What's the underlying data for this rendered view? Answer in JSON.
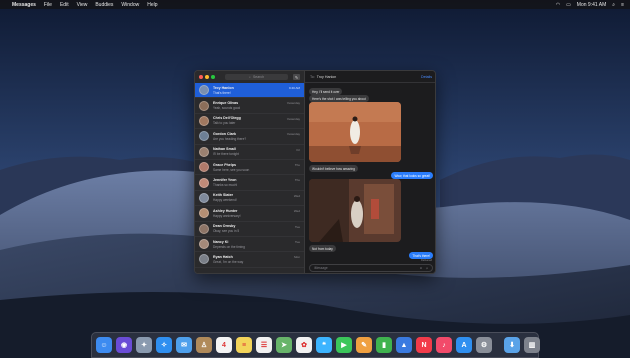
{
  "menubar": {
    "app_name": "Messages",
    "items": [
      "File",
      "Edit",
      "View",
      "Buddies",
      "Window",
      "Help"
    ],
    "clock": "Mon 9:41 AM"
  },
  "sidebar": {
    "search_placeholder": "Search",
    "conversations": [
      {
        "name": "Troy Hanlon",
        "preview": "That's there!",
        "time": "9:40 AM",
        "avatar_color": "#7a8fb0",
        "active": true
      },
      {
        "name": "Enrique Olivas",
        "preview": "Yeah, sounds good",
        "time": "Yesterday",
        "avatar_color": "#8c6e5a"
      },
      {
        "name": "Chris Dell'Olegg",
        "preview": "Talk to you later",
        "time": "Yesterday",
        "avatar_color": "#a07860"
      },
      {
        "name": "Gordon Clark",
        "preview": "Are you heading there?",
        "time": "Yesterday",
        "avatar_color": "#6d7f95"
      },
      {
        "name": "Nathan Small",
        "preview": "I'll be there tonight",
        "time": "Fri",
        "avatar_color": "#9a8070"
      },
      {
        "name": "Grace Phelps",
        "preview": "Same here, see you soon",
        "time": "Thu",
        "avatar_color": "#b07a6a"
      },
      {
        "name": "Jennifer Yeon",
        "preview": "Thanks so much!",
        "time": "Thu",
        "avatar_color": "#c08a78"
      },
      {
        "name": "Keith Slater",
        "preview": "Happy weekend!",
        "time": "Wed",
        "avatar_color": "#7f8a9c"
      },
      {
        "name": "Ashley Hunter",
        "preview": "Happy anniversary!",
        "time": "Wed",
        "avatar_color": "#b58f74"
      },
      {
        "name": "Dean Ornsby",
        "preview": "Okay, see you in 5",
        "time": "Tue",
        "avatar_color": "#8d7466"
      },
      {
        "name": "Nancy Ki",
        "preview": "Depends on the timing",
        "time": "Tue",
        "avatar_color": "#a58a7a"
      },
      {
        "name": "Ryan Hatch",
        "preview": "Great, I'm on the way",
        "time": "Mon",
        "avatar_color": "#7a7f88"
      }
    ]
  },
  "chat": {
    "to_label": "To:",
    "recipient": "Troy Hanlon",
    "details_label": "Details",
    "messages": [
      {
        "text": "Hey, I'll send it over",
        "dir": "in"
      },
      {
        "text": "Here's the shot I was telling you about",
        "dir": "in"
      },
      {
        "text": "Wouldn't believe how amazing",
        "dir": "in"
      },
      {
        "text": "Wow, that looks so great!",
        "dir": "out"
      },
      {
        "text": "Not from today",
        "dir": "in"
      },
      {
        "text": "That's there!",
        "dir": "out"
      }
    ],
    "delivered": "Delivered",
    "input_placeholder": "iMessage"
  },
  "dock": {
    "apps": [
      {
        "name": "finder",
        "color": "#3d8bf0",
        "glyph": "☺"
      },
      {
        "name": "siri",
        "color": "#6a4cd6",
        "glyph": "◉"
      },
      {
        "name": "launchpad",
        "color": "#8a9aaf",
        "glyph": "✦"
      },
      {
        "name": "safari",
        "color": "#2f8ff0",
        "glyph": "✧"
      },
      {
        "name": "mail",
        "color": "#4ea0ec",
        "glyph": "✉"
      },
      {
        "name": "contacts",
        "color": "#b08a5a",
        "glyph": "♙"
      },
      {
        "name": "calendar",
        "color": "#f4f4f4",
        "glyph": "4"
      },
      {
        "name": "notes",
        "color": "#f3d45a",
        "glyph": "≡"
      },
      {
        "name": "reminders",
        "color": "#f1f1f1",
        "glyph": "☰"
      },
      {
        "name": "maps",
        "color": "#68b46a",
        "glyph": "➤"
      },
      {
        "name": "photos",
        "color": "#f2f2f2",
        "glyph": "✿"
      },
      {
        "name": "messages",
        "color": "#3cb4ff",
        "glyph": "❝"
      },
      {
        "name": "facetime",
        "color": "#3bc65a",
        "glyph": "▶"
      },
      {
        "name": "pages",
        "color": "#f0a040",
        "glyph": "✎"
      },
      {
        "name": "numbers",
        "color": "#3fb34f",
        "glyph": "▮"
      },
      {
        "name": "keynote",
        "color": "#3a7ae0",
        "glyph": "▲"
      },
      {
        "name": "news",
        "color": "#f23b4a",
        "glyph": "N"
      },
      {
        "name": "music",
        "color": "#f24a6a",
        "glyph": "♪"
      },
      {
        "name": "app-store",
        "color": "#2f8ff0",
        "glyph": "A"
      },
      {
        "name": "system-preferences",
        "color": "#8a8f99",
        "glyph": "⚙"
      }
    ],
    "right_items": [
      {
        "name": "downloads",
        "color": "#5aa3e8",
        "glyph": "⬇"
      },
      {
        "name": "trash",
        "color": "#7d828c",
        "glyph": "▥"
      }
    ]
  }
}
